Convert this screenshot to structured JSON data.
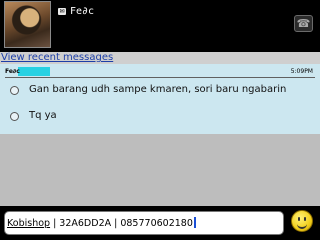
{
  "header": {
    "contact_name": "Fe∂c",
    "call_icon": "phone-icon"
  },
  "recent": {
    "label": "View recent messages"
  },
  "chat": {
    "sender": "Fe∂c",
    "time": "5:09PM",
    "messages": [
      {
        "text": "Gan barang udh sampe kmaren, sori baru ngabarin"
      },
      {
        "text": "Tq ya"
      }
    ]
  },
  "composer": {
    "link": "Kobishop",
    "rest": " | 32A6DD2A | 085770602180",
    "emoji_icon": "smiley-icon"
  },
  "colors": {
    "header_bg": "#000000",
    "chat_bg": "#cce7f0",
    "highlight": "#27d1e3",
    "link": "#1d3fa8"
  }
}
